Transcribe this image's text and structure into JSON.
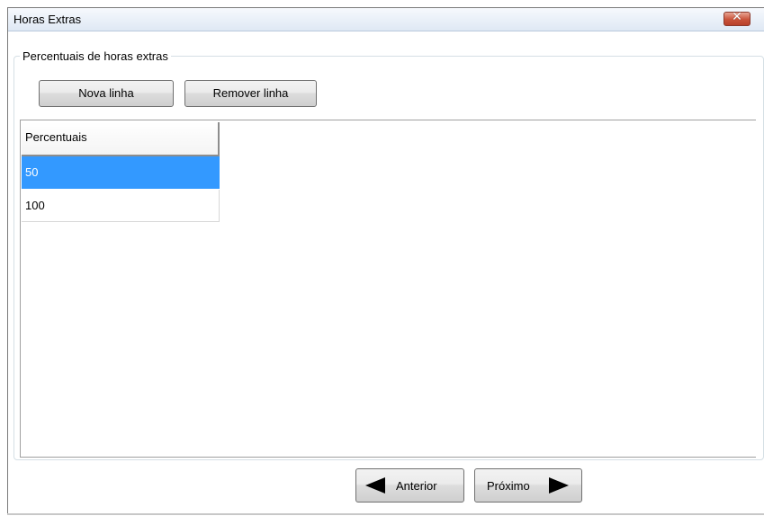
{
  "window": {
    "title": "Horas Extras",
    "close_icon": "close-icon"
  },
  "group": {
    "legend": "Percentuais de horas extras",
    "buttons": {
      "add_label": "Nova linha",
      "remove_label": "Remover linha"
    }
  },
  "table": {
    "columns": [
      "Percentuais"
    ],
    "rows": [
      {
        "value": "50",
        "selected": true
      },
      {
        "value": "100",
        "selected": false
      }
    ]
  },
  "navigation": {
    "previous_label": "Anterior",
    "previous_icon": "arrow-left-icon",
    "next_label": "Próximo",
    "next_icon": "arrow-right-icon"
  },
  "colors": {
    "selection": "#3399ff",
    "close_button": "#c9533a"
  }
}
